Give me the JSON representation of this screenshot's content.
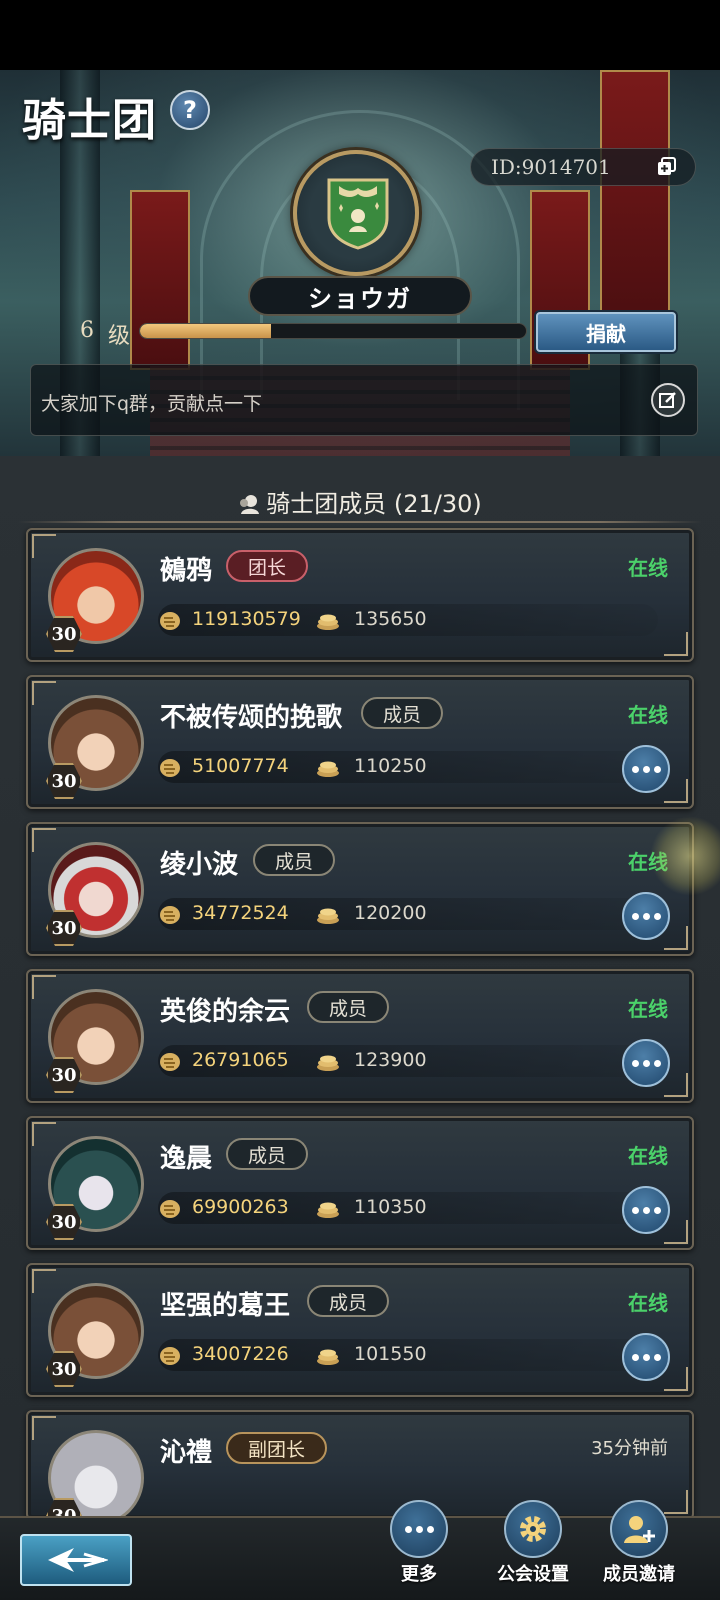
{
  "header": {
    "title": "骑士团",
    "help_icon": "help-icon",
    "guild_id": "ID:9014701",
    "guild_name": "ショウガ",
    "level": "6",
    "level_label": "级",
    "xp_progress": 0.34,
    "donate_label": "捐献",
    "notice": "大家加下q群，贡献点一下"
  },
  "members_section": {
    "title": "骑士团成员 (21/30)"
  },
  "members": [
    {
      "name": "鵺鸦",
      "role": "团长",
      "role_type": "leader",
      "level": "30",
      "stat1": "119130579",
      "stat2": "135650",
      "status": "在线",
      "show_more": false
    },
    {
      "name": "不被传颂的挽歌",
      "role": "成员",
      "role_type": "member",
      "level": "30",
      "stat1": "51007774",
      "stat2": "110250",
      "status": "在线",
      "show_more": true
    },
    {
      "name": "绫小波",
      "role": "成员",
      "role_type": "member",
      "level": "30",
      "stat1": "34772524",
      "stat2": "120200",
      "status": "在线",
      "show_more": true
    },
    {
      "name": "英俊的余云",
      "role": "成员",
      "role_type": "member",
      "level": "30",
      "stat1": "26791065",
      "stat2": "123900",
      "status": "在线",
      "show_more": true
    },
    {
      "name": "逸晨",
      "role": "成员",
      "role_type": "member",
      "level": "30",
      "stat1": "69900263",
      "stat2": "110350",
      "status": "在线",
      "show_more": true
    },
    {
      "name": "坚强的葛王",
      "role": "成员",
      "role_type": "member",
      "level": "30",
      "stat1": "34007226",
      "stat2": "101550",
      "status": "在线",
      "show_more": true
    },
    {
      "name": "沁禮",
      "role": "副团长",
      "role_type": "vice",
      "level": "30",
      "stat1": "",
      "stat2": "",
      "status": "35分钟前",
      "show_more": false
    }
  ],
  "bottom_bar": {
    "more_label": "更多",
    "settings_label": "公会设置",
    "invite_label": "成员邀请"
  },
  "colors": {
    "online": "#4bd16a",
    "accent_gold": "#b89a62",
    "button_blue": "#2b5a85"
  }
}
